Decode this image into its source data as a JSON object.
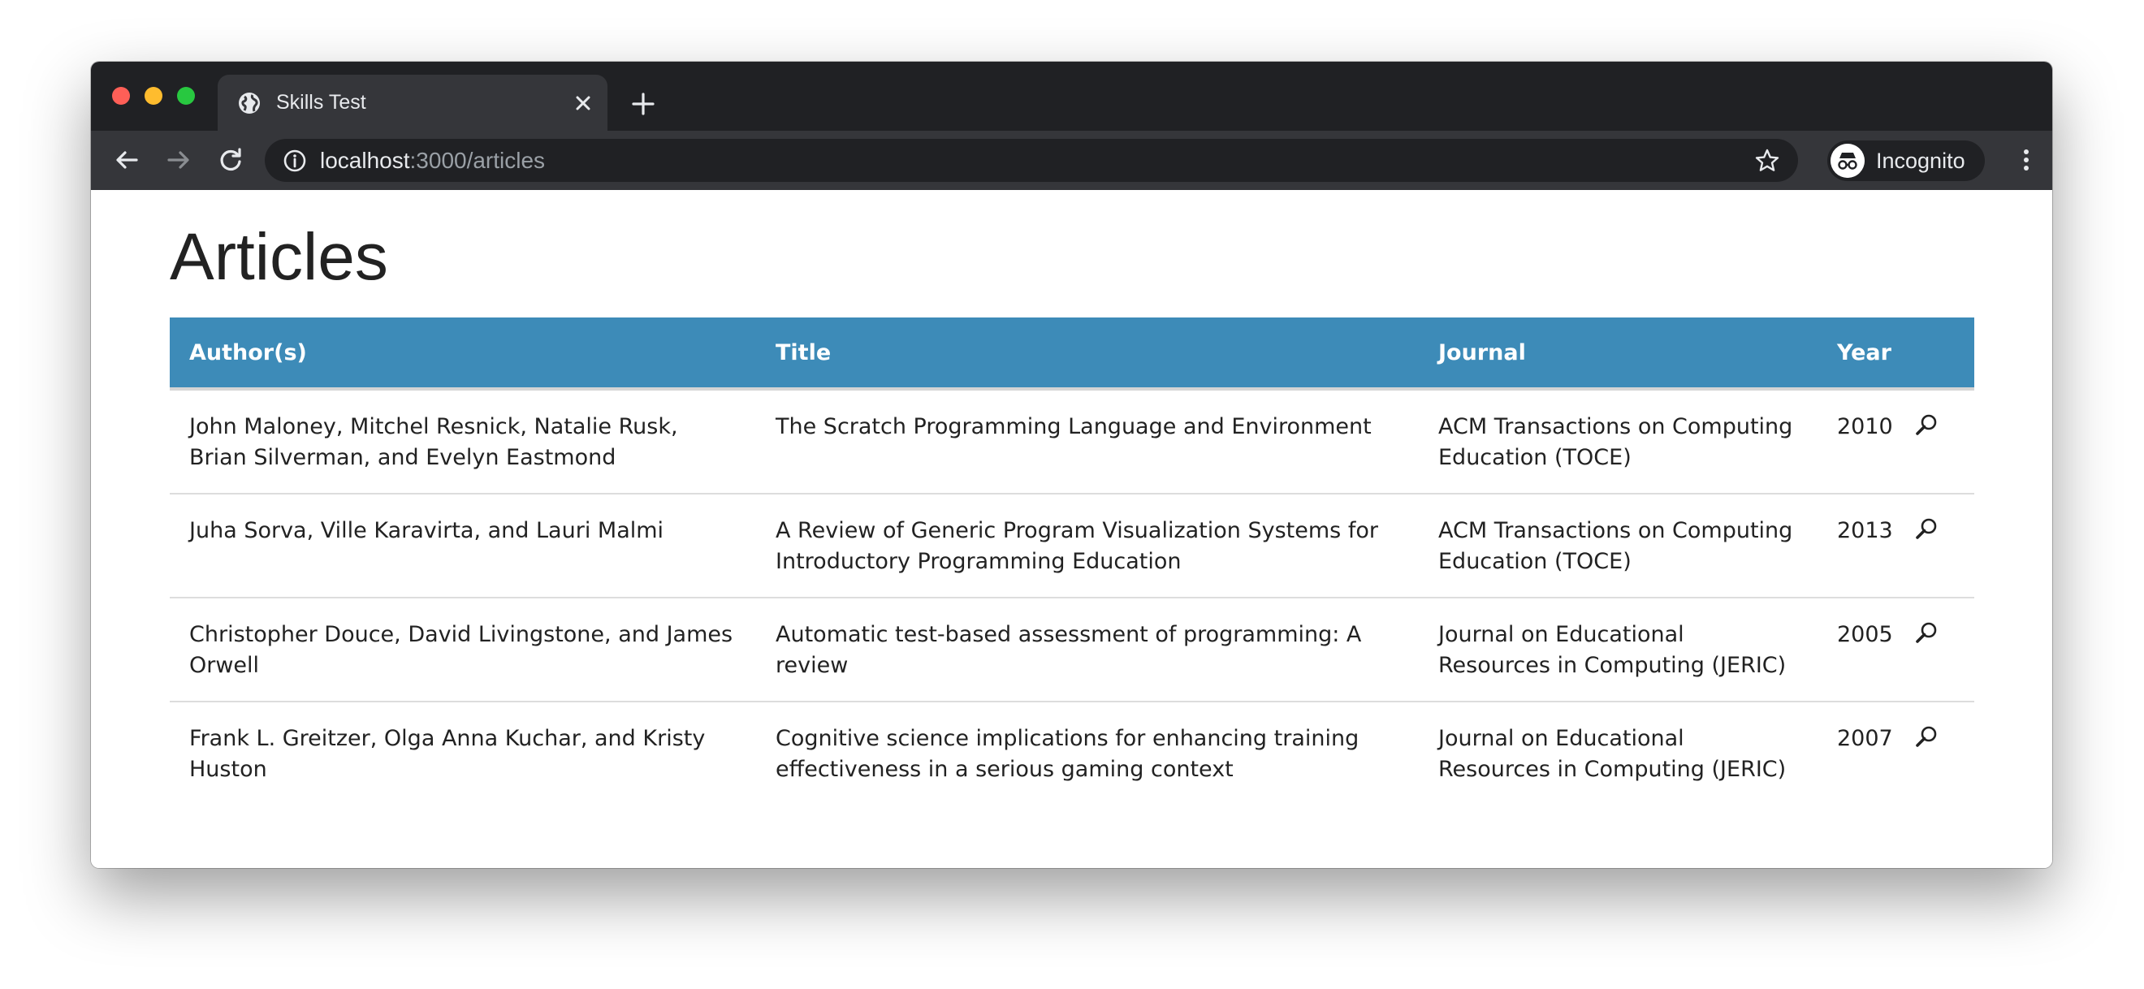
{
  "browser": {
    "tab": {
      "title": "Skills Test"
    },
    "address": {
      "host": "localhost",
      "rest": ":3000/articles"
    },
    "profile": {
      "label": "Incognito"
    }
  },
  "page": {
    "heading": "Articles",
    "table": {
      "headers": {
        "authors": "Author(s)",
        "title": "Title",
        "journal": "Journal",
        "year": "Year"
      },
      "rows": [
        {
          "authors": "John Maloney, Mitchel Resnick, Natalie Rusk, Brian Silverman, and Evelyn Eastmond",
          "title": "The Scratch Programming Language and Environment",
          "journal": "ACM Transactions on Computing Education (TOCE)",
          "year": "2010",
          "action_icon": "magnifier-icon"
        },
        {
          "authors": "Juha Sorva, Ville Karavirta, and Lauri Malmi",
          "title": "A Review of Generic Program Visualization Systems for Introductory Programming Education",
          "journal": "ACM Transactions on Computing Education (TOCE)",
          "year": "2013",
          "action_icon": "magnifier-icon"
        },
        {
          "authors": "Christopher Douce, David Livingstone, and James Orwell",
          "title": "Automatic test-based assessment of programming: A review",
          "journal": "Journal on Educational Resources in Computing (JERIC)",
          "year": "2005",
          "action_icon": "magnifier-icon"
        },
        {
          "authors": "Frank L. Greitzer, Olga Anna Kuchar, and Kristy Huston",
          "title": "Cognitive science implications for enhancing training effectiveness in a serious gaming context",
          "journal": "Journal on Educational Resources in Computing (JERIC)",
          "year": "2007",
          "action_icon": "magnifier-icon"
        }
      ]
    }
  },
  "colors": {
    "header_bg": "#3d8bb8",
    "chrome_dark": "#202124",
    "chrome_toolbar": "#35363a"
  }
}
